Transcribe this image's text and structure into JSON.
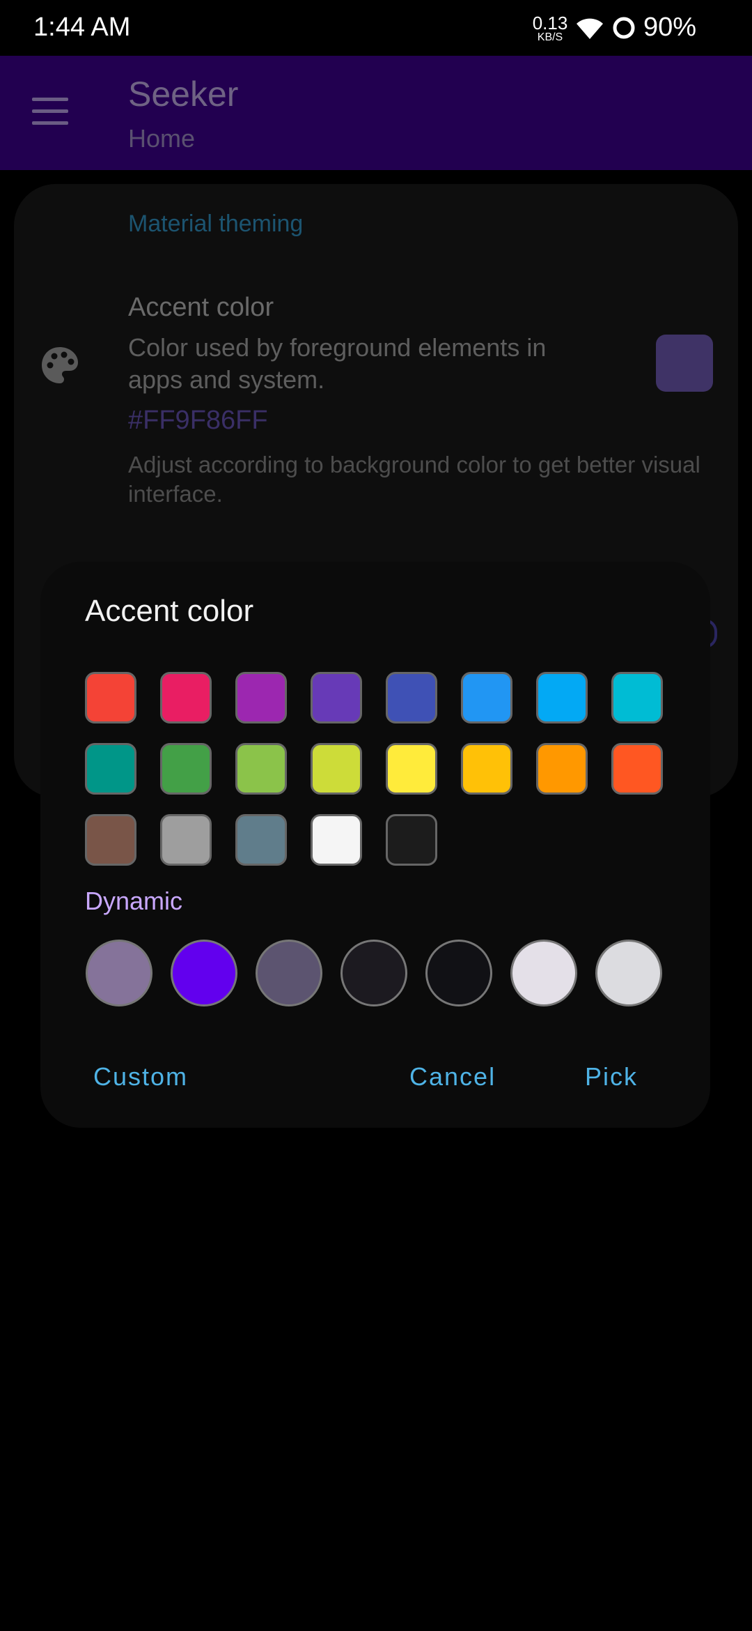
{
  "status_bar": {
    "time": "1:44 AM",
    "net_speed_value": "0.13",
    "net_speed_unit": "KB/S",
    "battery": "90%"
  },
  "toolbar": {
    "title": "Seeker",
    "subtitle": "Home",
    "menu_icon": "menu-icon"
  },
  "settings": {
    "section_title": "Material theming",
    "item": {
      "icon": "palette-icon",
      "title": "Accent color",
      "description": "Color used by foreground elements in apps and system.",
      "value_hex": "#FF9F86FF",
      "note": "Adjust according to background color to get better visual interface.",
      "preview_color": "#3f3366"
    }
  },
  "dialog": {
    "title": "Accent color",
    "palette": [
      "#f44336",
      "#e91e63",
      "#9c27b0",
      "#673ab7",
      "#3f51b5",
      "#2196f3",
      "#03a9f4",
      "#00bcd4",
      "#009688",
      "#43a047",
      "#8bc34a",
      "#cddc39",
      "#ffeb3b",
      "#ffc107",
      "#ff9800",
      "#ff5722",
      "#795548",
      "#9e9e9e",
      "#607d8b",
      "#f5f5f5",
      "#1c1c1c"
    ],
    "dynamic_label": "Dynamic",
    "dynamic_colors": [
      "#85739a",
      "#6200ee",
      "#5c5470",
      "#1c1a20",
      "#111115",
      "#e4e0e8",
      "#dcdce0"
    ],
    "buttons": {
      "custom": "Custom",
      "cancel": "Cancel",
      "pick": "Pick"
    }
  }
}
